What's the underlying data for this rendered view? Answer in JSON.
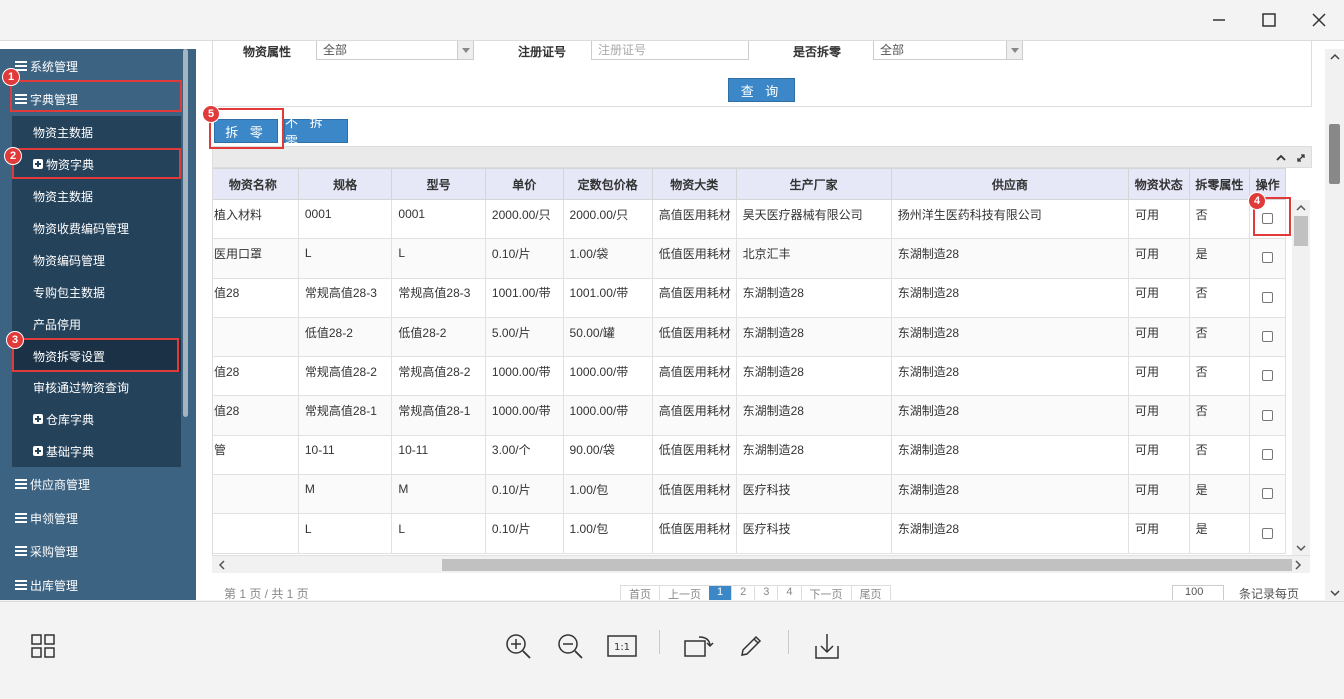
{
  "window": {
    "minimize_icon": "minimize-icon",
    "maximize_icon": "maximize-icon",
    "close_icon": "close-icon"
  },
  "sidebar": {
    "items": [
      {
        "label": "系统管理",
        "level": 1
      },
      {
        "label": "字典管理",
        "level": 1
      },
      {
        "label": "物资主数据",
        "level": 2
      },
      {
        "label": "物资字典",
        "level": 2,
        "icon": "plus-box-icon"
      },
      {
        "label": "物资主数据",
        "level": 2
      },
      {
        "label": "物资收费编码管理",
        "level": 2
      },
      {
        "label": "物资编码管理",
        "level": 2
      },
      {
        "label": "专购包主数据",
        "level": 2
      },
      {
        "label": "产品停用",
        "level": 2
      },
      {
        "label": "物资拆零设置",
        "level": 2,
        "selected": true
      },
      {
        "label": "审核通过物资查询",
        "level": 2
      },
      {
        "label": "仓库字典",
        "level": 2,
        "icon": "plus-box-icon"
      },
      {
        "label": "基础字典",
        "level": 2,
        "icon": "plus-box-icon"
      },
      {
        "label": "供应商管理",
        "level": 1
      },
      {
        "label": "申领管理",
        "level": 1
      },
      {
        "label": "采购管理",
        "level": 1
      },
      {
        "label": "出库管理",
        "level": 1
      }
    ]
  },
  "annotations": [
    "1",
    "2",
    "3",
    "4",
    "5"
  ],
  "filter": {
    "attr_label": "物资属性",
    "attr_value": "全部",
    "reg_label": "注册证号",
    "reg_placeholder": "注册证号",
    "split_label": "是否拆零",
    "split_value": "全部",
    "query_button": "查 询"
  },
  "actions": {
    "split_button": "拆 零",
    "nosplit_button": "不 拆 零"
  },
  "table": {
    "headers": [
      "物资名称",
      "规格",
      "型号",
      "单价",
      "定数包价格",
      "物资大类",
      "生产厂家",
      "供应商",
      "物资状态",
      "拆零属性",
      "操作"
    ],
    "rows": [
      [
        "植入材料",
        "0001",
        "0001",
        "2000.00/只",
        "2000.00/只",
        "高值医用耗材",
        "昊天医疗器械有限公司",
        "扬州洋生医药科技有限公司",
        "可用",
        "否"
      ],
      [
        "医用口罩",
        "L",
        "L",
        "0.10/片",
        "1.00/袋",
        "低值医用耗材",
        "北京汇丰",
        "东湖制造28",
        "可用",
        "是"
      ],
      [
        "值28",
        "常规高值28-3",
        "常规高值28-3",
        "1001.00/带",
        "1001.00/带",
        "高值医用耗材",
        "东湖制造28",
        "东湖制造28",
        "可用",
        "否"
      ],
      [
        "",
        "低值28-2",
        "低值28-2",
        "5.00/片",
        "50.00/罐",
        "低值医用耗材",
        "东湖制造28",
        "东湖制造28",
        "可用",
        "否"
      ],
      [
        "值28",
        "常规高值28-2",
        "常规高值28-2",
        "1000.00/带",
        "1000.00/带",
        "高值医用耗材",
        "东湖制造28",
        "东湖制造28",
        "可用",
        "否"
      ],
      [
        "值28",
        "常规高值28-1",
        "常规高值28-1",
        "1000.00/带",
        "1000.00/带",
        "高值医用耗材",
        "东湖制造28",
        "东湖制造28",
        "可用",
        "否"
      ],
      [
        "管",
        "10-11",
        "10-11",
        "3.00/个",
        "90.00/袋",
        "低值医用耗材",
        "东湖制造28",
        "东湖制造28",
        "可用",
        "否"
      ],
      [
        "",
        "M",
        "M",
        "0.10/片",
        "1.00/包",
        "低值医用耗材",
        "医疗科技",
        "东湖制造28",
        "可用",
        "是"
      ],
      [
        "",
        "L",
        "L",
        "0.10/片",
        "1.00/包",
        "低值医用耗材",
        "医疗科技",
        "东湖制造28",
        "可用",
        "是"
      ]
    ]
  },
  "pager": {
    "summary": "第 1 页 / 共 1 页",
    "first": "首页",
    "prev": "上一页",
    "pages": [
      "1",
      "2",
      "3",
      "4"
    ],
    "next": "下一页",
    "last": "尾页",
    "page_size": "100",
    "per_page_label": "条记录每页"
  }
}
